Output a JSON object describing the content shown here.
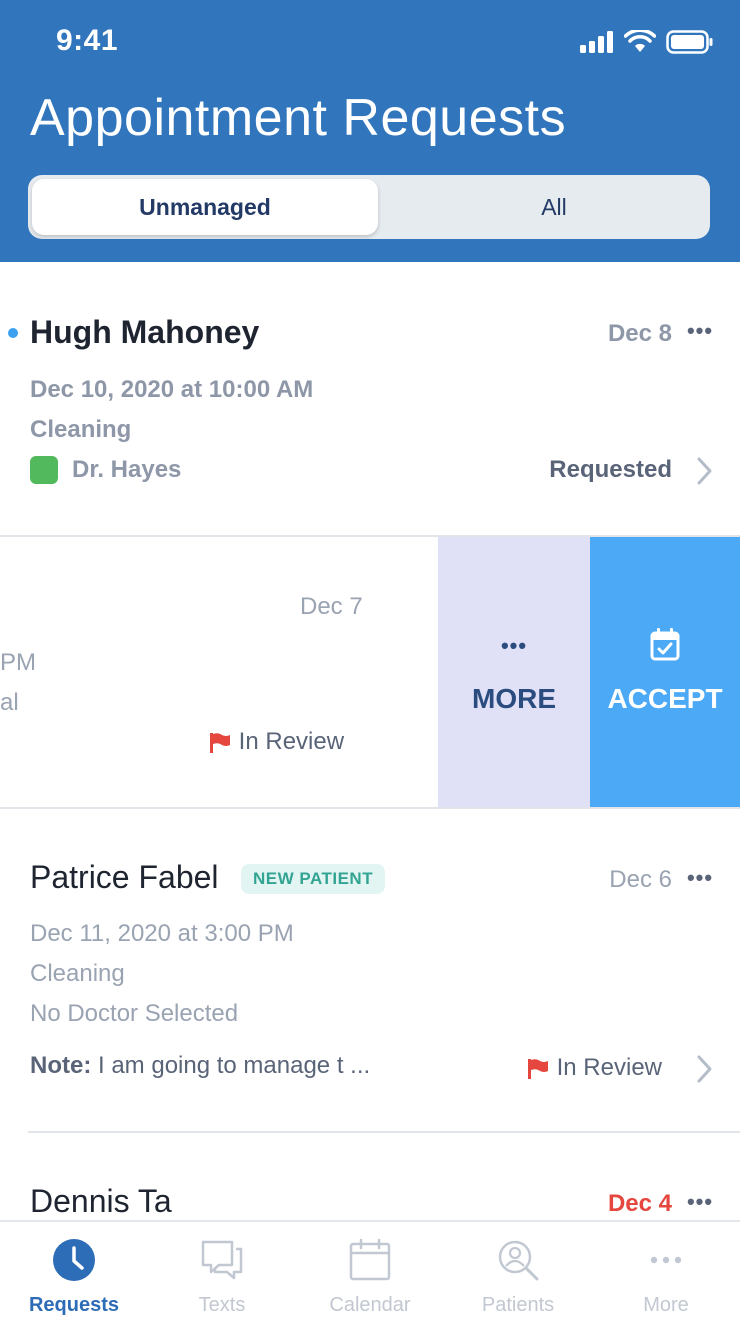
{
  "status_bar": {
    "time": "9:41"
  },
  "header": {
    "title": "Appointment Requests"
  },
  "segments": {
    "active": "Unmanaged",
    "inactive": "All"
  },
  "cards": [
    {
      "name": "Hugh Mahoney",
      "date": "Dec 8",
      "datetime": "Dec 10, 2020 at 10:00 AM",
      "type": "Cleaning",
      "doctor": "Dr. Hayes",
      "doctor_color": "#52b95d",
      "status": "Requested",
      "unread": true
    },
    {
      "date": "Dec 7",
      "datetime_fragment": "PM",
      "type_fragment": "al",
      "status": "In Review"
    },
    {
      "name": "Patrice Fabel",
      "badge": "NEW PATIENT",
      "date": "Dec 6",
      "datetime": "Dec 11, 2020 at 3:00 PM",
      "type": "Cleaning",
      "doctor": "No Doctor Selected",
      "note_label": "Note:",
      "note_text": " I am going to manage t ...",
      "status": "In Review"
    },
    {
      "name": "Dennis Ta",
      "date": "Dec 4",
      "date_color": "#e5463d"
    }
  ],
  "swipe_actions": {
    "more": "MORE",
    "accept": "ACCEPT"
  },
  "colors": {
    "header": "#3176bc",
    "accept": "#4ba9f5",
    "more": "#e0e0f7",
    "flag": "#e5463d"
  },
  "tab_bar": [
    {
      "label": "Requests",
      "icon": "clock-icon",
      "active": true
    },
    {
      "label": "Texts",
      "icon": "chat-bubble-icon",
      "active": false
    },
    {
      "label": "Calendar",
      "icon": "calendar-icon",
      "active": false
    },
    {
      "label": "Patients",
      "icon": "patient-search-icon",
      "active": false
    },
    {
      "label": "More",
      "icon": "more-dots-icon",
      "active": false
    }
  ]
}
